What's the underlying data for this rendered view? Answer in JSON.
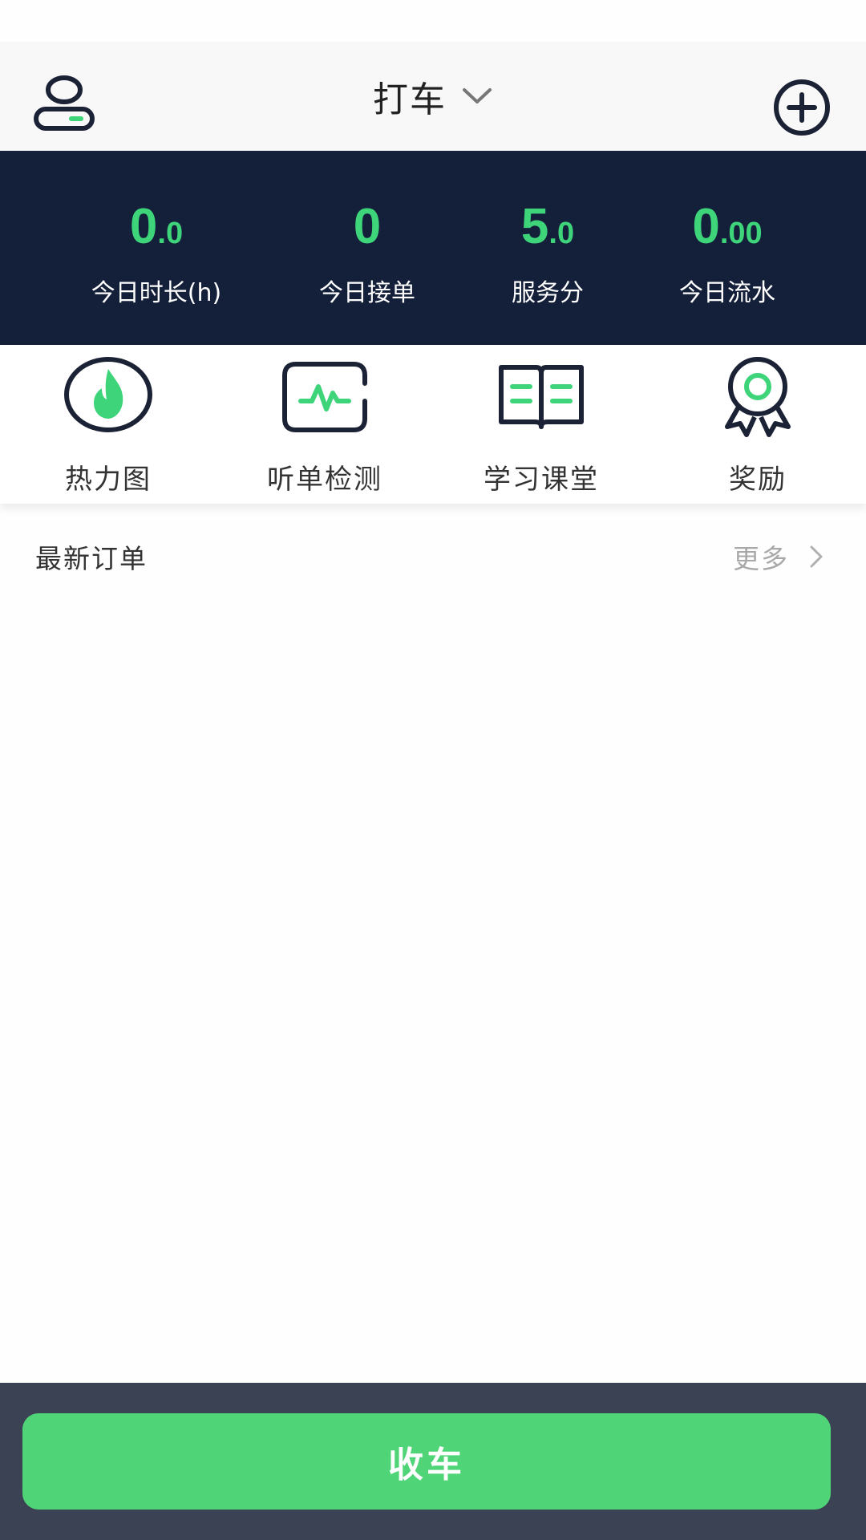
{
  "header": {
    "title": "打车"
  },
  "stats": [
    {
      "value_int": "0",
      "value_dec": ".0",
      "label": "今日时长(h)"
    },
    {
      "value_int": "0",
      "value_dec": "",
      "label": "今日接单"
    },
    {
      "value_int": "5",
      "value_dec": ".0",
      "label": "服务分"
    },
    {
      "value_int": "0",
      "value_dec": ".00",
      "label": "今日流水"
    }
  ],
  "tools": [
    {
      "label": "热力图",
      "icon": "flame-icon"
    },
    {
      "label": "听单检测",
      "icon": "pulse-monitor-icon"
    },
    {
      "label": "学习课堂",
      "icon": "open-book-icon"
    },
    {
      "label": "奖励",
      "icon": "award-medal-icon"
    }
  ],
  "orders": {
    "title": "最新订单",
    "more_label": "更多"
  },
  "bottom": {
    "end_shift_label": "收车"
  },
  "colors": {
    "accent_green": "#4fd477",
    "stat_green": "#3dd47a",
    "navy": "#141f3a",
    "bottom_bar": "#3b4254"
  }
}
